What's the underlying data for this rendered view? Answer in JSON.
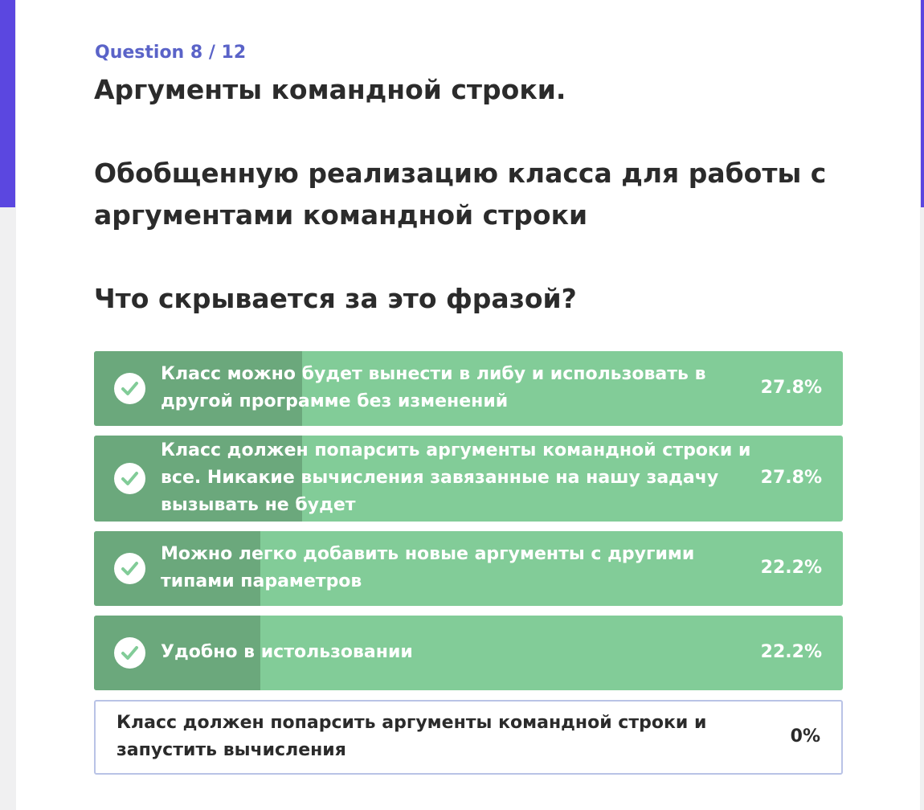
{
  "colors": {
    "accent": "#5b47e0",
    "question_label": "#5a63c8",
    "answered_bar": "#82cc98",
    "answered_fill": "#6ba87c",
    "check_mark": "#82cc98",
    "unanswered_border": "#b9c3e6",
    "text_dark": "#2b2b2b"
  },
  "header": {
    "progress": "Question 8 / 12"
  },
  "question": {
    "lines": [
      "Аргументы командной строки.",
      "",
      "Обобщенную реализацию класса для работы с",
      "аргументами командной строки",
      "",
      "Что скрывается за это фразой?"
    ]
  },
  "options": [
    {
      "lines": [
        "Класс можно будет вынести в либу и использовать в",
        "другой программе без изменений"
      ],
      "percent": "27.8%",
      "share": 0.278,
      "answered": true,
      "icon": "check-circle-icon"
    },
    {
      "lines": [
        "Класс должен попарсить аргументы командной строки и",
        "все. Никакие вычисления завязанные на нашу задачу",
        "вызывать не будет"
      ],
      "percent": "27.8%",
      "share": 0.278,
      "answered": true,
      "icon": "check-circle-icon"
    },
    {
      "lines": [
        "Можно легко добавить новые аргументы с другими",
        "типами параметров"
      ],
      "percent": "22.2%",
      "share": 0.222,
      "answered": true,
      "icon": "check-circle-icon"
    },
    {
      "lines": [
        "Удобно в истользовании"
      ],
      "percent": "22.2%",
      "share": 0.222,
      "answered": true,
      "icon": "check-circle-icon"
    },
    {
      "lines": [
        "Класс должен попарсить аргументы командной строки и",
        "запустить вычисления"
      ],
      "percent": "0%",
      "share": 0,
      "answered": false
    }
  ]
}
